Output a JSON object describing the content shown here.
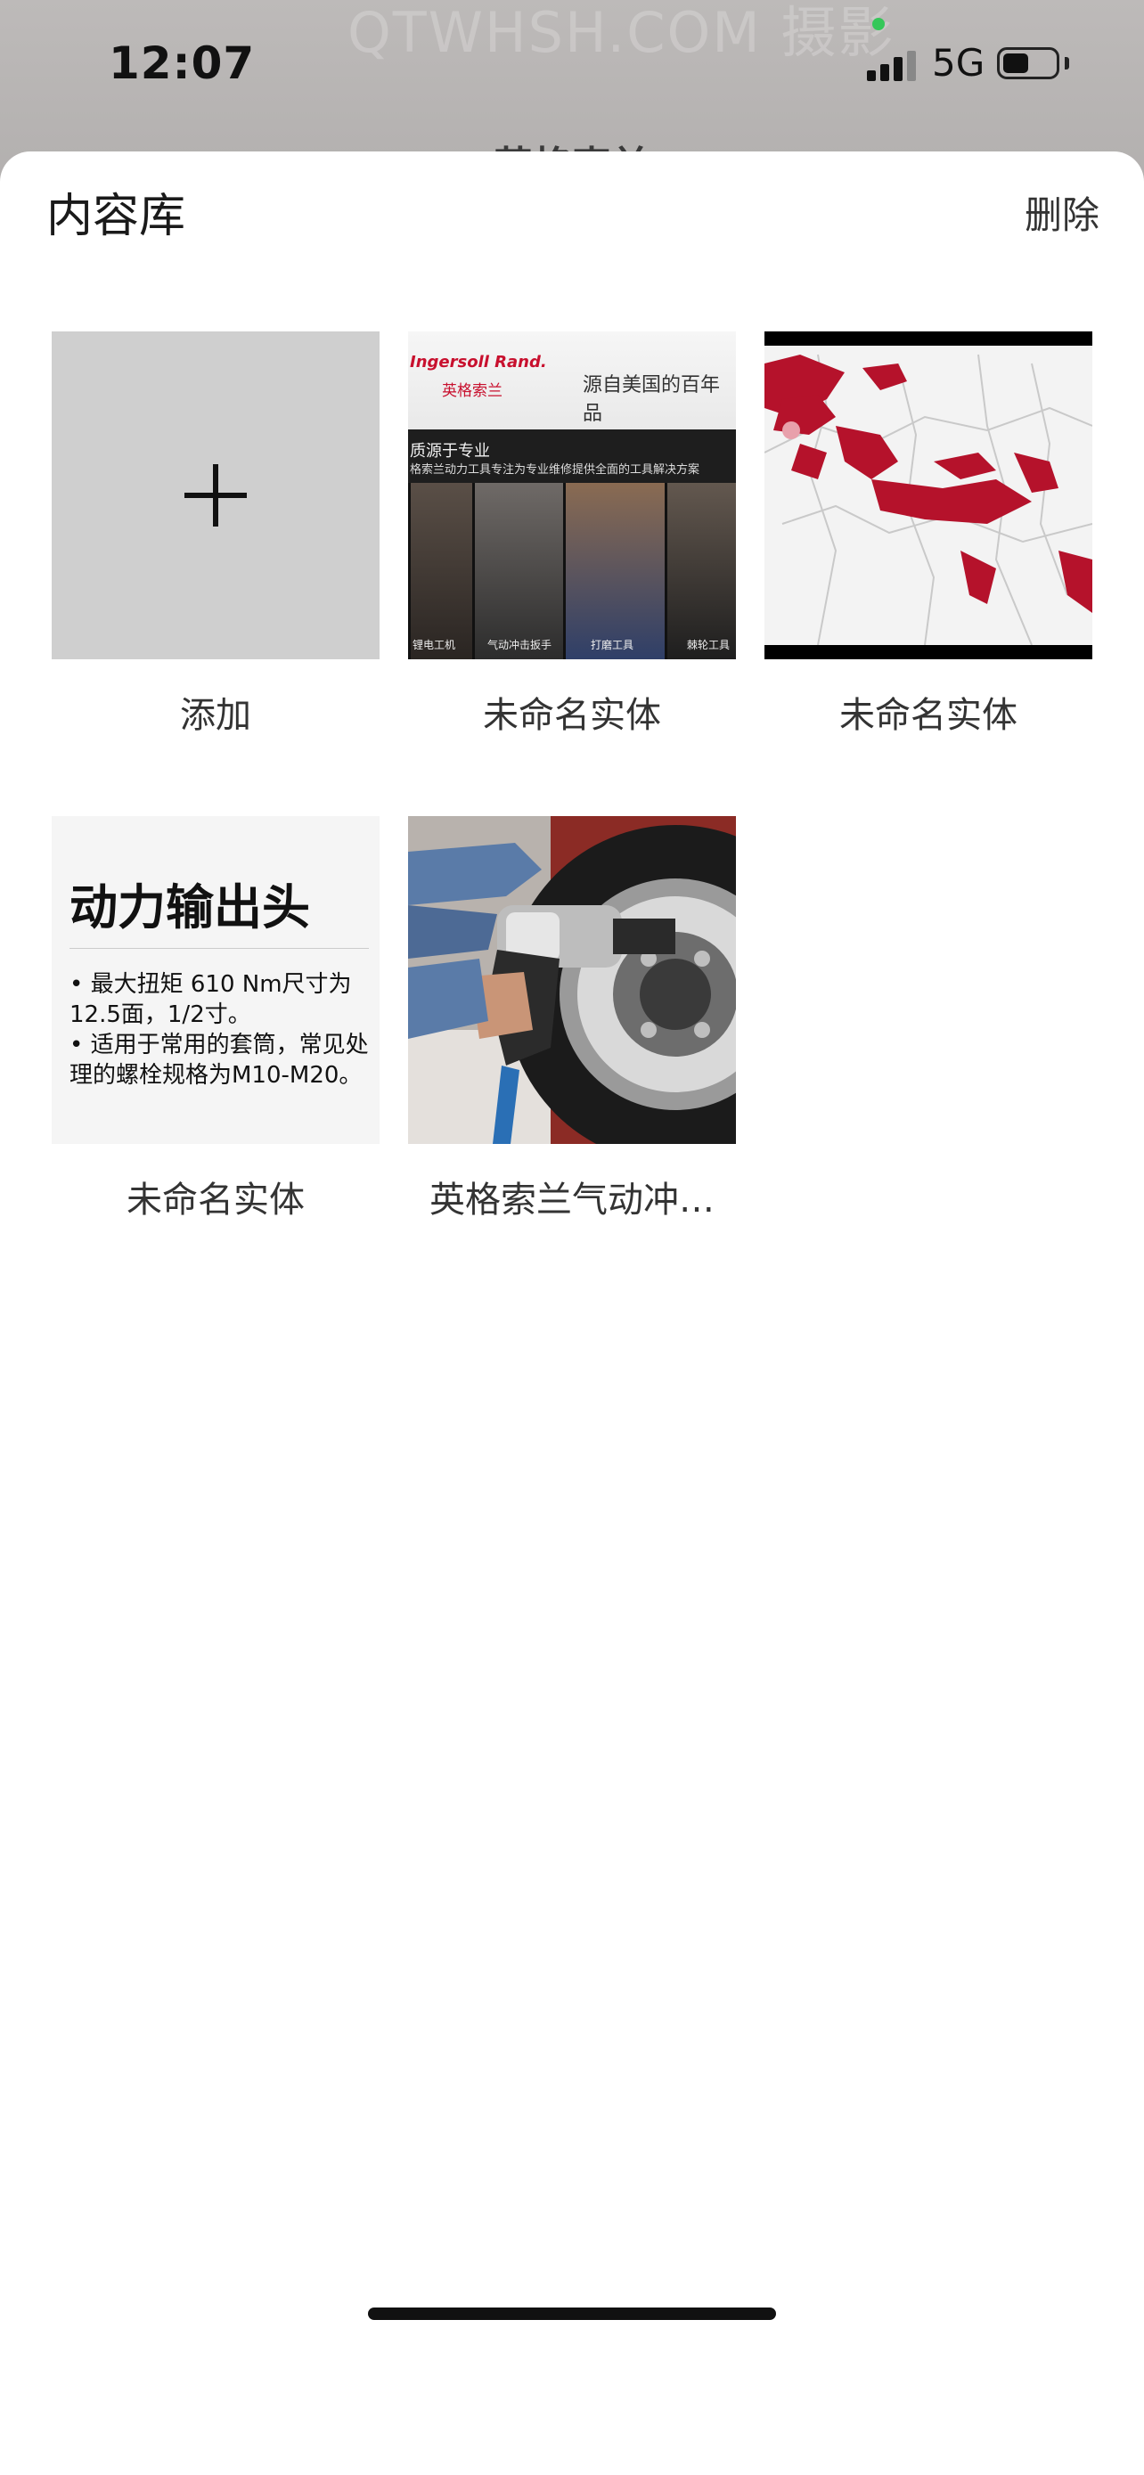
{
  "status_bar": {
    "time": "12:07",
    "network": "5G"
  },
  "background": {
    "watermark": "QTWHSH.COM 摄影",
    "page_title": "英格索兰"
  },
  "sheet": {
    "title": "内容库",
    "delete_label": "删除"
  },
  "items": [
    {
      "caption": "添加",
      "type": "add",
      "icon": "plus-icon"
    },
    {
      "caption": "未命名实体",
      "type": "image",
      "thumb": {
        "logo": "Ingersoll Rand.",
        "logo_cn": "英格索兰",
        "slogan": "源自美国的百年品",
        "heading": "质源于专业",
        "subheading": "格索兰动力工具专注为专业维修提供全面的工具解决方案",
        "labels": [
          "锂电工机",
          "气动冲击扳手",
          "打磨工具",
          "棘轮工具"
        ]
      }
    },
    {
      "caption": "未命名实体",
      "type": "image",
      "thumb": {
        "description": "map"
      }
    },
    {
      "caption": "未命名实体",
      "type": "text-card",
      "thumb": {
        "title": "动力输出头",
        "lines": [
          "• 最大扭矩 610 Nm尺寸为12.5面，1/2寸。",
          "• 适用于常用的套筒，常见处理的螺栓规格为M10-M20。"
        ]
      }
    },
    {
      "caption": "英格索兰气动冲…",
      "type": "image",
      "thumb": {
        "description": "impact wrench on wheel"
      }
    }
  ],
  "colors": {
    "brand_red": "#c8102e",
    "status_green": "#35c759"
  }
}
